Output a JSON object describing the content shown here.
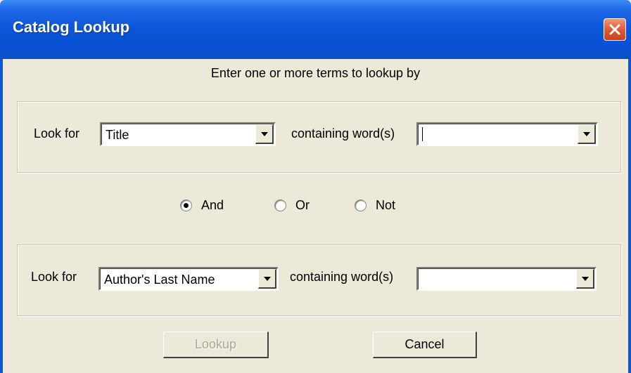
{
  "window": {
    "title": "Catalog Lookup"
  },
  "instructions": "Enter one or more terms to lookup by",
  "row1": {
    "look_for_label": "Look for",
    "field_value": "Title",
    "containing_label": "containing word(s)",
    "words_value": ""
  },
  "operators": {
    "options": [
      "And",
      "Or",
      "Not"
    ],
    "selected": "And"
  },
  "row2": {
    "look_for_label": "Look for",
    "field_value": "Author's Last Name",
    "containing_label": "containing word(s)",
    "words_value": ""
  },
  "buttons": {
    "lookup": "Lookup",
    "cancel": "Cancel",
    "lookup_enabled": false
  },
  "colors": {
    "titlebar": "#0a55d8",
    "face": "#ece9d8",
    "close": "#e05a36"
  }
}
